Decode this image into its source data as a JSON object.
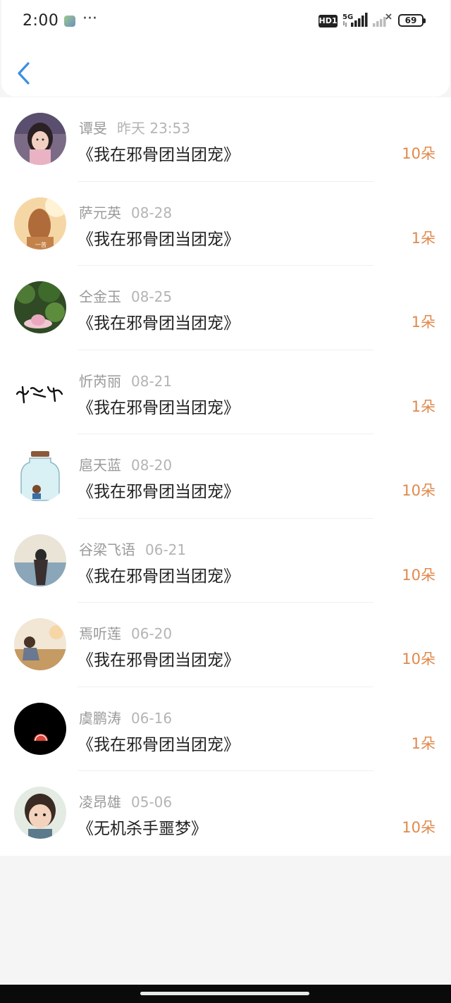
{
  "status_bar": {
    "time": "2:00",
    "more": "···",
    "hd_label": "HD1",
    "network_label": "5G",
    "battery_level": "69"
  },
  "header": {
    "back_icon": "chevron-left-icon",
    "accent_color": "#3a8ee6"
  },
  "colors": {
    "amount": "#e0894c",
    "name": "#9a9a9a",
    "date": "#b4b4b4"
  },
  "gifts": [
    {
      "name": "谭旻",
      "date": "昨天 23:53",
      "book": "《我在邪骨团当团宠》",
      "amount": "10朵",
      "avatar": "girl-portrait"
    },
    {
      "name": "萨元英",
      "date": "08-28",
      "book": "《我在邪骨团当团宠》",
      "amount": "1朵",
      "avatar": "back-of-head"
    },
    {
      "name": "仝金玉",
      "date": "08-25",
      "book": "《我在邪骨团当团宠》",
      "amount": "1朵",
      "avatar": "plants-hat"
    },
    {
      "name": "忻芮丽",
      "date": "08-21",
      "book": "《我在邪骨团当团宠》",
      "amount": "1朵",
      "avatar": "calligraphy"
    },
    {
      "name": "扈天蓝",
      "date": "08-20",
      "book": "《我在邪骨团当团宠》",
      "amount": "10朵",
      "avatar": "jar-boy"
    },
    {
      "name": "谷梁飞语",
      "date": "06-21",
      "book": "《我在邪骨团当团宠》",
      "amount": "10朵",
      "avatar": "lake-girl"
    },
    {
      "name": "焉听莲",
      "date": "06-20",
      "book": "《我在邪骨团当团宠》",
      "amount": "10朵",
      "avatar": "autumn-girl"
    },
    {
      "name": "虞鹏涛",
      "date": "06-16",
      "book": "《我在邪骨团当团宠》",
      "amount": "1朵",
      "avatar": "black-watermelon"
    },
    {
      "name": "凌昂雄",
      "date": "05-06",
      "book": "《无机杀手噩梦》",
      "amount": "10朵",
      "avatar": "boy-portrait"
    }
  ]
}
